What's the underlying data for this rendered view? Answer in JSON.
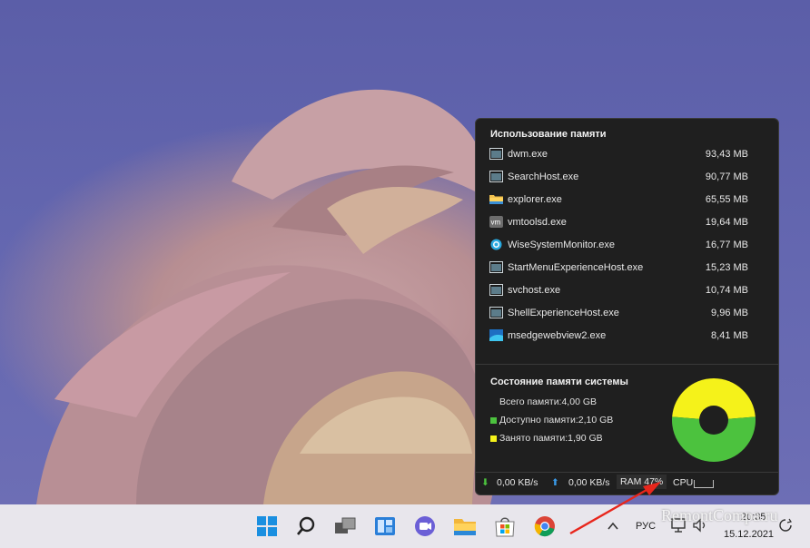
{
  "memory_usage": {
    "title": "Использование памяти",
    "processes": [
      {
        "name": "dwm.exe",
        "size": "93,43 MB",
        "icon": "window-app-icon"
      },
      {
        "name": "SearchHost.exe",
        "size": "90,77 MB",
        "icon": "window-app-icon"
      },
      {
        "name": "explorer.exe",
        "size": "65,55 MB",
        "icon": "folder-icon"
      },
      {
        "name": "vmtoolsd.exe",
        "size": "19,64 MB",
        "icon": "vm-icon"
      },
      {
        "name": "WiseSystemMonitor.exe",
        "size": "16,77 MB",
        "icon": "wise-monitor-icon"
      },
      {
        "name": "StartMenuExperienceHost.exe",
        "size": "15,23 MB",
        "icon": "window-app-icon"
      },
      {
        "name": "svchost.exe",
        "size": "10,74 MB",
        "icon": "window-app-icon"
      },
      {
        "name": "ShellExperienceHost.exe",
        "size": "9,96 MB",
        "icon": "window-app-icon"
      },
      {
        "name": "msedgewebview2.exe",
        "size": "8,41 MB",
        "icon": "edge-webview-icon"
      }
    ]
  },
  "system_memory": {
    "title": "Состояние памяти системы",
    "total": "Всего памяти:4,00 GB",
    "available": "Доступно памяти:2,10 GB",
    "used": "Занято памяти:1,90 GB",
    "available_color": "#4cc23e",
    "used_color": "#f5f21a",
    "used_fraction": 0.475
  },
  "footer": {
    "download": "0,00 KB/s",
    "upload": "0,00 KB/s",
    "ram": "RAM 47%",
    "cpu": "CPU"
  },
  "taskbar": {
    "language": "РУС",
    "time": "20:35",
    "date": "15.12.2021",
    "watermark": "RemontCompa.ru"
  }
}
